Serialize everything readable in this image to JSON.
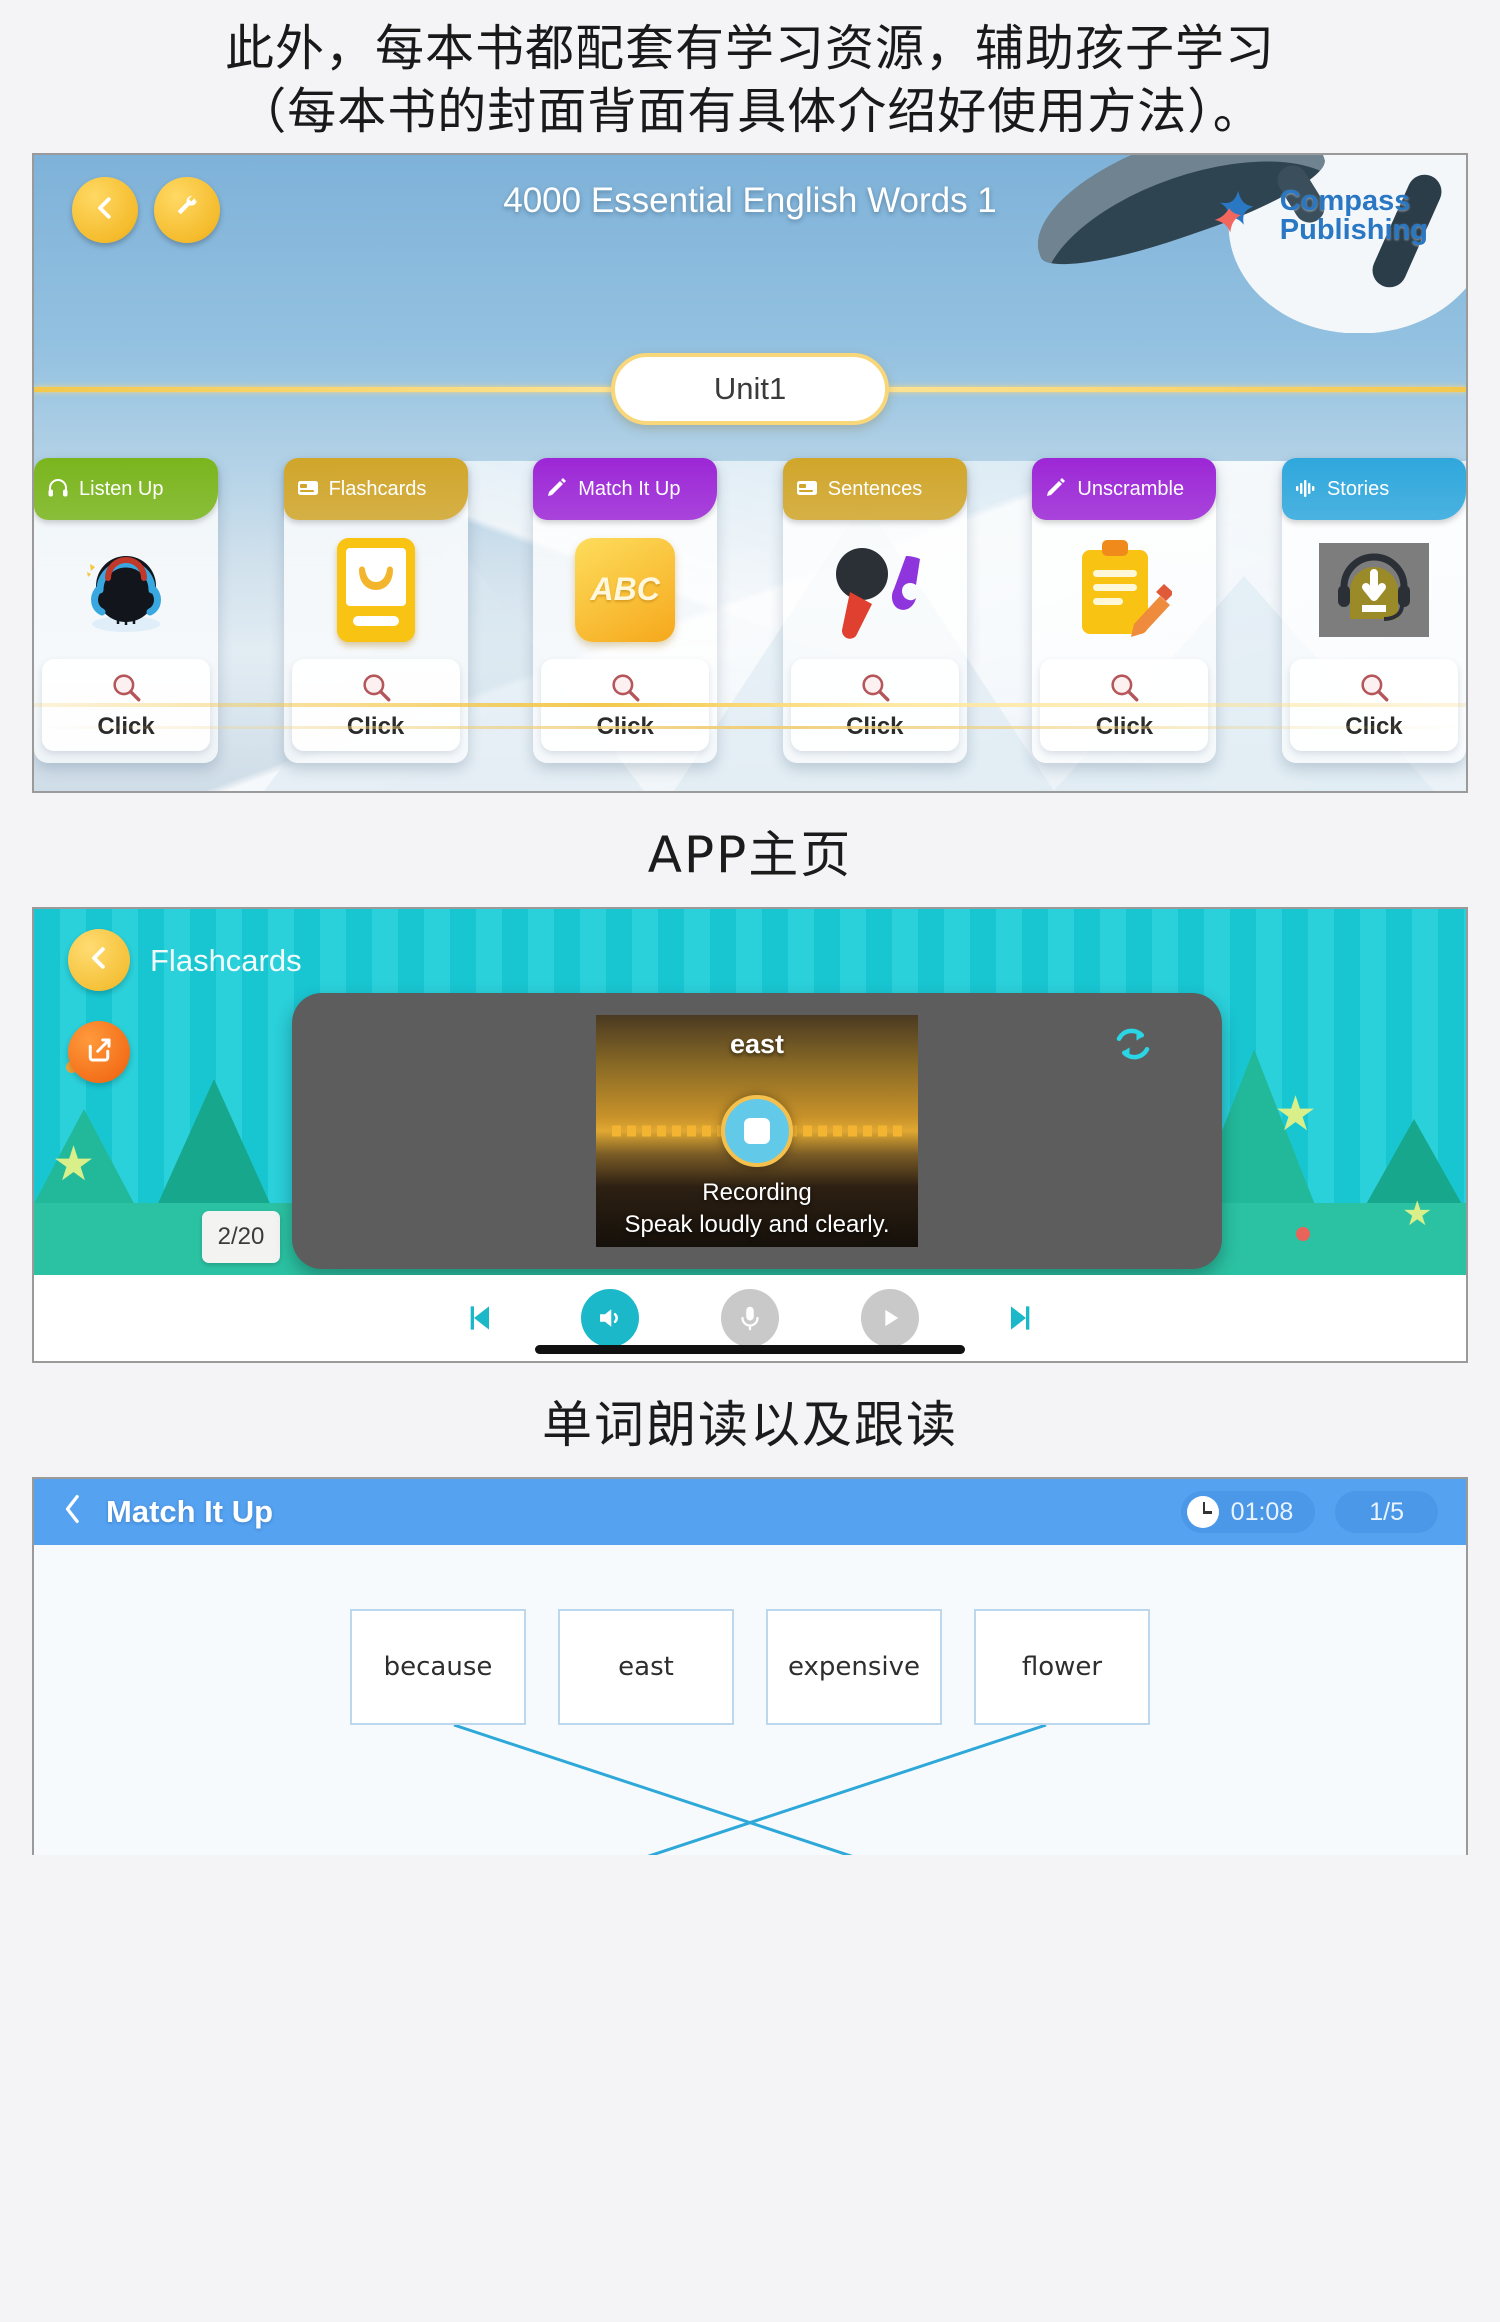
{
  "intro": {
    "line1": "此外，每本书都配套有学习资源，辅助孩子学习",
    "line2": "（每本书的封面背面有具体介绍好使用方法）。"
  },
  "home": {
    "caption": "APP主页",
    "title": "4000 Essential English Words 1",
    "unit": "Unit1",
    "brand_line1": "Compass",
    "brand_line2": "Publishing",
    "back_icon": "chevron-left-icon",
    "settings_icon": "wrench-icon",
    "click_label": "Click",
    "cards": [
      {
        "label": "Listen Up",
        "icon": "headphone-icon",
        "color": "#7ab51d",
        "art": "penguin"
      },
      {
        "label": "Flashcards",
        "icon": "card-icon",
        "color": "#d0a52a",
        "art": "book"
      },
      {
        "label": "Match It Up",
        "icon": "pencil-icon",
        "color": "#9c27d6",
        "art": "abc"
      },
      {
        "label": "Sentences",
        "icon": "card-icon",
        "color": "#d0a52a",
        "art": "mic"
      },
      {
        "label": "Unscramble",
        "icon": "pencil-icon",
        "color": "#9c27d6",
        "art": "clipboard"
      },
      {
        "label": "Stories",
        "icon": "waveform-icon",
        "color": "#2fa7dc",
        "art": "stories"
      }
    ]
  },
  "flashcards": {
    "caption": "单词朗读以及跟读",
    "title": "Flashcards",
    "back_icon": "chevron-left-icon",
    "share_icon": "share-icon",
    "loop_icon": "repeat-icon",
    "counter": "2/20",
    "word": "east",
    "status": "Recording",
    "hint": "Speak loudly and clearly.",
    "player": [
      {
        "name": "previous-track",
        "icon": "skip-back-icon",
        "state": "teal-flat"
      },
      {
        "name": "speaker",
        "icon": "speaker-icon",
        "state": "teal-filled"
      },
      {
        "name": "microphone",
        "icon": "mic-icon",
        "state": "gray-filled"
      },
      {
        "name": "play",
        "icon": "play-icon",
        "state": "gray-filled"
      },
      {
        "name": "next-track",
        "icon": "skip-forward-icon",
        "state": "teal-flat"
      }
    ]
  },
  "match": {
    "title": "Match It Up",
    "back_icon": "chevron-left-icon",
    "clock_icon": "clock-icon",
    "timer": "01:08",
    "counter": "1/5",
    "words": [
      "because",
      "east",
      "expensive",
      "flower"
    ],
    "answers": [
      "",
      "",
      "",
      ""
    ],
    "connections": [
      {
        "from": 0,
        "to": 2
      },
      {
        "from": 3,
        "to": 1
      }
    ]
  },
  "colors": {
    "accent_blue": "#55a2f0",
    "teal": "#1ab8c9",
    "yellow": "#f5c23a",
    "orange": "#f4701a",
    "purple": "#9c27d6",
    "gold": "#d0a52a",
    "green": "#7ab51d"
  }
}
